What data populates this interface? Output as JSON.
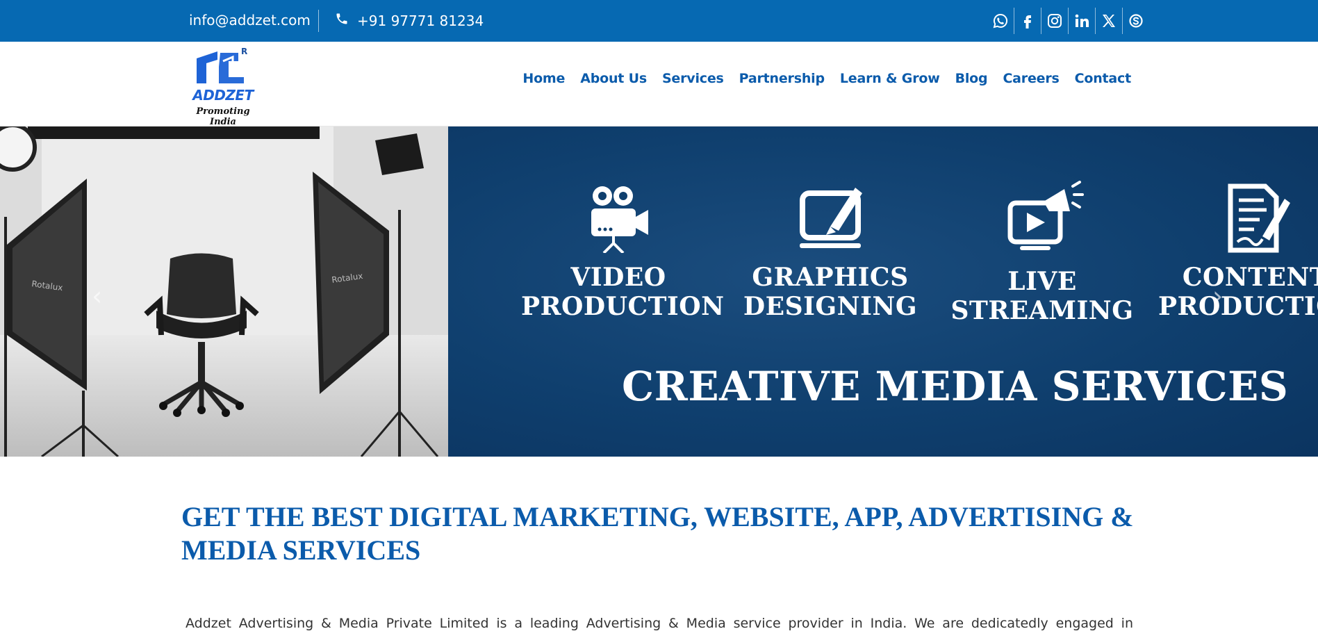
{
  "topbar": {
    "email": "info@addzet.com",
    "phone": "+91 97771 81234",
    "background": "#0669b2"
  },
  "socials": [
    {
      "name": "whatsapp-icon"
    },
    {
      "name": "facebook-icon"
    },
    {
      "name": "instagram-icon"
    },
    {
      "name": "linkedin-icon"
    },
    {
      "name": "x-twitter-icon"
    },
    {
      "name": "skype-icon"
    }
  ],
  "logo": {
    "brand": "ADDZET",
    "registered": "R",
    "tagline": "Promoting India"
  },
  "nav": {
    "items": [
      "Home",
      "About Us",
      "Services",
      "Partnership",
      "Learn & Grow",
      "Blog",
      "Careers",
      "Contact"
    ],
    "color": "#0b5bab"
  },
  "hero": {
    "services": [
      {
        "line1": "VIDEO",
        "line2": "PRODUCTION",
        "icon": "video-camera-icon"
      },
      {
        "line1": "GRAPHICS",
        "line2": "DESIGNING",
        "icon": "design-laptop-icon"
      },
      {
        "line1": "LIVE",
        "line2": "STREAMING",
        "icon": "live-stream-icon"
      },
      {
        "line1": "CONTENT",
        "line2": "PRODUCTION",
        "icon": "content-document-icon"
      }
    ],
    "headline": "CREATIVE MEDIA SERVICES",
    "prev_arrow": "‹",
    "next_arrow": "›",
    "photo_brand": "Rotalux"
  },
  "content": {
    "title": "GET THE BEST DIGITAL MARKETING, WEBSITE, APP, ADVERTISING & MEDIA SERVICES",
    "intro": "Addzet Advertising & Media Private Limited is a leading Advertising & Media service provider in India. We are dedicatedly engaged in simplifying your"
  }
}
